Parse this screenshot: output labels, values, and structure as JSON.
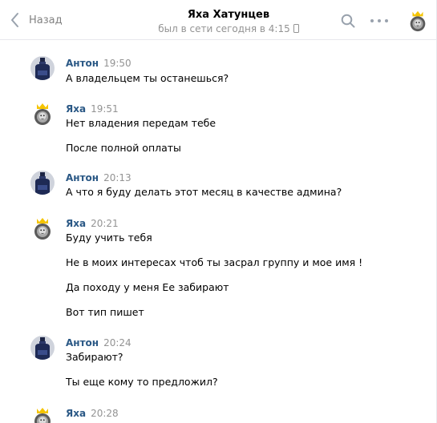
{
  "header": {
    "back_label": "Назад",
    "peer_name": "Яха Хатунцев",
    "peer_status": "был в сети сегодня в 4:15",
    "status_device_icon": "mobile-phone-icon",
    "search_icon": "search-icon",
    "more_icon": "more-dots-icon",
    "avatar_icon": "lion-crown-avatar"
  },
  "colors": {
    "author_link": "#2a5885",
    "muted_text": "#939393",
    "divider": "#e7e8ec",
    "icon_gray": "#99a2ad"
  },
  "messages": [
    {
      "author": "Антон",
      "time": "19:50",
      "lines": [
        "А владельцем ты останешься?"
      ]
    },
    {
      "author": "Яха",
      "time": "19:51",
      "lines": [
        "Нет владения передам тебе",
        "После полной оплаты"
      ]
    },
    {
      "author": "Антон",
      "time": "20:13",
      "lines": [
        "А что я буду делать этот месяц в качестве админа?"
      ]
    },
    {
      "author": "Яха",
      "time": "20:21",
      "lines": [
        "Буду учить тебя",
        "Не в моих интересах чтоб ты засрал группу и мое имя !",
        "Да походу у меня Ее забирают",
        "Вот тип пишет"
      ]
    },
    {
      "author": "Антон",
      "time": "20:24",
      "lines": [
        "Забирают?",
        "Ты еще кому то предложил?"
      ]
    },
    {
      "author": "Яха",
      "time": "20:28",
      "lines": []
    }
  ]
}
